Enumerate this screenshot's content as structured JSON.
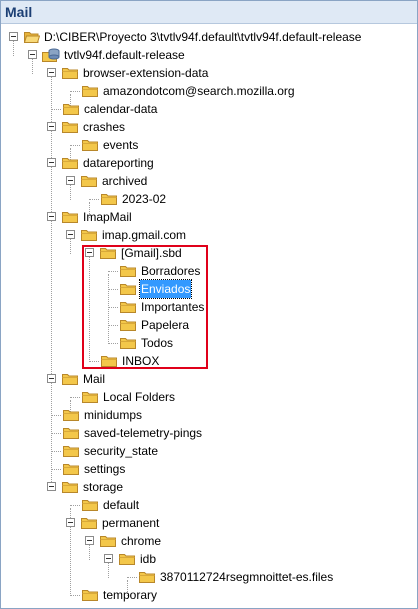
{
  "window": {
    "title": "Mail"
  },
  "tree": [
    {
      "label": "D:\\CIBER\\Proyecto 3\\tvtlv94f.default\\tvtlv94f.default-release",
      "icon": "open-folder-icon",
      "expander": true
    },
    {
      "label": "tvtlv94f.default-release",
      "icon": "database-icon",
      "expander": true
    },
    {
      "label": "browser-extension-data",
      "icon": "folder-icon",
      "expander": true
    },
    {
      "label": "amazondotcom@search.mozilla.org",
      "icon": "folder-icon",
      "expander": false
    },
    {
      "label": "calendar-data",
      "icon": "folder-icon",
      "expander": false
    },
    {
      "label": "crashes",
      "icon": "folder-icon",
      "expander": true
    },
    {
      "label": "events",
      "icon": "folder-icon",
      "expander": false
    },
    {
      "label": "datareporting",
      "icon": "folder-icon",
      "expander": true
    },
    {
      "label": "archived",
      "icon": "folder-icon",
      "expander": true
    },
    {
      "label": "2023-02",
      "icon": "folder-icon",
      "expander": false
    },
    {
      "label": "ImapMail",
      "icon": "folder-icon",
      "expander": true
    },
    {
      "label": "imap.gmail.com",
      "icon": "folder-icon",
      "expander": true
    },
    {
      "label": "[Gmail].sbd",
      "icon": "folder-icon",
      "expander": true
    },
    {
      "label": "Borradores",
      "icon": "folder-icon",
      "expander": false
    },
    {
      "label": "Enviados",
      "icon": "folder-icon",
      "expander": false,
      "selected": true
    },
    {
      "label": "Importantes",
      "icon": "folder-icon",
      "expander": false
    },
    {
      "label": "Papelera",
      "icon": "folder-icon",
      "expander": false
    },
    {
      "label": "Todos",
      "icon": "folder-icon",
      "expander": false
    },
    {
      "label": "INBOX",
      "icon": "folder-icon",
      "expander": false
    },
    {
      "label": "Mail",
      "icon": "folder-icon",
      "expander": true
    },
    {
      "label": "Local Folders",
      "icon": "folder-icon",
      "expander": false
    },
    {
      "label": "minidumps",
      "icon": "folder-icon",
      "expander": false
    },
    {
      "label": "saved-telemetry-pings",
      "icon": "folder-icon",
      "expander": false
    },
    {
      "label": "security_state",
      "icon": "folder-icon",
      "expander": false
    },
    {
      "label": "settings",
      "icon": "folder-icon",
      "expander": false
    },
    {
      "label": "storage",
      "icon": "folder-icon",
      "expander": true
    },
    {
      "label": "default",
      "icon": "folder-icon",
      "expander": false
    },
    {
      "label": "permanent",
      "icon": "folder-icon",
      "expander": true
    },
    {
      "label": "chrome",
      "icon": "folder-icon",
      "expander": true
    },
    {
      "label": "idb",
      "icon": "folder-icon",
      "expander": true
    },
    {
      "label": "3870112724rsegmnoittet-es.files",
      "icon": "folder-icon",
      "expander": false
    },
    {
      "label": "temporary",
      "icon": "folder-icon",
      "expander": false
    }
  ],
  "colors": {
    "selection": "#3399ff",
    "highlight_border": "#e0001a",
    "folder": "#f3c74a"
  }
}
